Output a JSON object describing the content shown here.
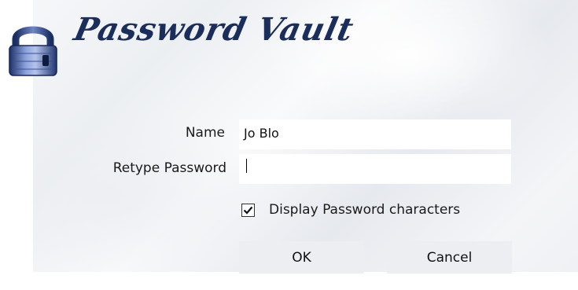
{
  "header": {
    "title": "Password Vault",
    "icon": "padlock-icon"
  },
  "form": {
    "name_label": "Name",
    "name_value": "Jo Blo",
    "retype_label": "Retype  Password",
    "retype_value": "",
    "display_chars_label": "Display Password characters",
    "display_chars_checked": true
  },
  "buttons": {
    "ok_label": "OK",
    "cancel_label": "Cancel"
  },
  "colors": {
    "title": "#1b2d5a",
    "button_bg": "#eceef2"
  }
}
